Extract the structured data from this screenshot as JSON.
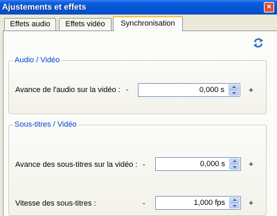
{
  "window": {
    "title": "Ajustements et effets",
    "close_glyph": "×"
  },
  "tabs": [
    {
      "label": "Effets audio",
      "active": false
    },
    {
      "label": "Effets vidéo",
      "active": false
    },
    {
      "label": "Synchronisation",
      "active": true
    }
  ],
  "icons": {
    "sync": "sync-arrows-icon"
  },
  "audio_video": {
    "legend": "Audio / Vidéo",
    "audio_delay": {
      "label": "Avance de l'audio sur la vidéo :",
      "minus": "-",
      "value": "0,000 s",
      "plus": "+"
    }
  },
  "subs_video": {
    "legend": "Sous-titres / Vidéo",
    "subs_delay": {
      "label": "Avance des sous-titres sur la vidéo :",
      "minus": "-",
      "value": "0,000 s",
      "plus": "+"
    },
    "subs_speed": {
      "label": "Vitesse des sous-titres :",
      "minus": "-",
      "value": "1,000 fps",
      "plus": "+"
    }
  },
  "colors": {
    "titlebar": "#0554d3",
    "legend_text": "#0046d5",
    "tab_highlight": "#f5c33b"
  }
}
